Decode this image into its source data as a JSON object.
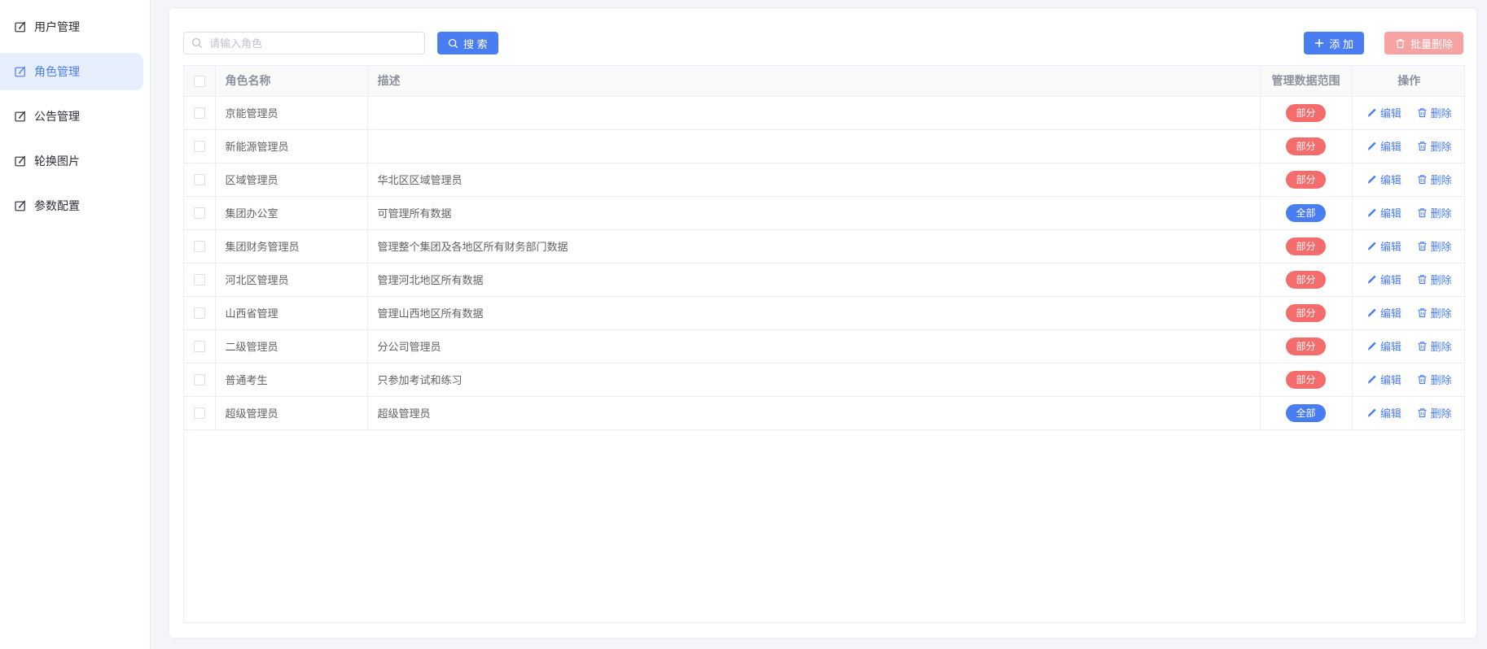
{
  "sidebar": {
    "items": [
      {
        "label": "用户管理",
        "active": false
      },
      {
        "label": "角色管理",
        "active": true
      },
      {
        "label": "公告管理",
        "active": false
      },
      {
        "label": "轮换图片",
        "active": false
      },
      {
        "label": "参数配置",
        "active": false
      }
    ]
  },
  "toolbar": {
    "search_placeholder": "请输入角色",
    "search_label": "搜 索",
    "add_label": "添 加",
    "batch_delete_label": "批量删除"
  },
  "table": {
    "headers": {
      "name": "角色名称",
      "desc": "描述",
      "scope": "管理数据范围",
      "actions": "操作"
    },
    "edit_label": "编辑",
    "delete_label": "删除",
    "rows": [
      {
        "name": "京能管理员",
        "desc": "",
        "scope": "部分",
        "scope_type": "partial"
      },
      {
        "name": "新能源管理员",
        "desc": "",
        "scope": "部分",
        "scope_type": "partial"
      },
      {
        "name": "区域管理员",
        "desc": "华北区区域管理员",
        "scope": "部分",
        "scope_type": "partial"
      },
      {
        "name": "集团办公室",
        "desc": "可管理所有数据",
        "scope": "全部",
        "scope_type": "all"
      },
      {
        "name": "集团财务管理员",
        "desc": "管理整个集团及各地区所有财务部门数据",
        "scope": "部分",
        "scope_type": "partial"
      },
      {
        "name": "河北区管理员",
        "desc": "管理河北地区所有数据",
        "scope": "部分",
        "scope_type": "partial"
      },
      {
        "name": "山西省管理",
        "desc": "管理山西地区所有数据",
        "scope": "部分",
        "scope_type": "partial"
      },
      {
        "name": "二级管理员",
        "desc": "分公司管理员",
        "scope": "部分",
        "scope_type": "partial"
      },
      {
        "name": "普通考生",
        "desc": "只参加考试和练习",
        "scope": "部分",
        "scope_type": "partial"
      },
      {
        "name": "超级管理员",
        "desc": "超级管理员",
        "scope": "全部",
        "scope_type": "all"
      }
    ]
  },
  "colors": {
    "accent_blue": "#4a7df2",
    "badge_red": "#f56c6c",
    "batch_delete_disabled": "#f7a3a3",
    "sidebar_active_bg": "#e8effc",
    "page_bg": "#f4f5f8"
  }
}
